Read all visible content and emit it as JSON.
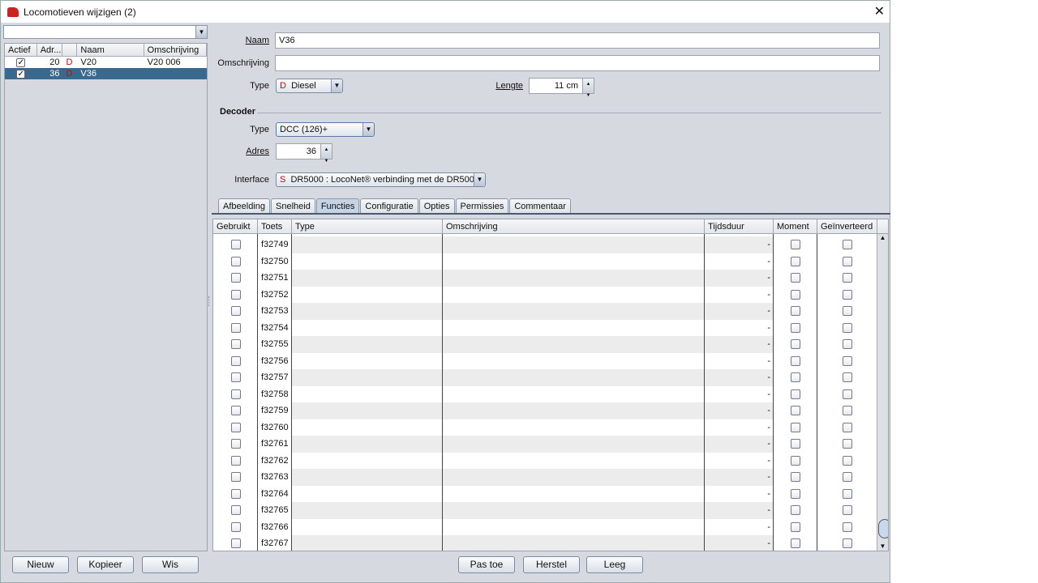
{
  "window": {
    "title": "Locomotieven wijzigen (2)",
    "close": "✕"
  },
  "left": {
    "filter_value": "",
    "columns": [
      "Actief",
      "Adr...",
      "",
      "Naam",
      "Omschrijving"
    ],
    "rows": [
      {
        "actief": true,
        "adres": "20",
        "type": "D",
        "naam": "V20",
        "omschrijving": "V20 006",
        "selected": false
      },
      {
        "actief": true,
        "adres": "36",
        "type": "D",
        "naam": "V36",
        "omschrijving": "",
        "selected": true
      }
    ],
    "buttons": [
      "Nieuw",
      "Kopieer",
      "Wis"
    ]
  },
  "form": {
    "naam_label": "Naam",
    "naam_value": "V36",
    "omschrijving_label": "Omschrijving",
    "omschrijving_value": "",
    "type_label": "Type",
    "type_prefix": "D",
    "type_value": "Diesel",
    "lengte_label": "Lengte",
    "lengte_value": "11 cm",
    "decoder_heading": "Decoder",
    "dec_type_label": "Type",
    "dec_type_value": "DCC (126)+",
    "adres_label": "Adres",
    "adres_value": "36",
    "interface_label": "Interface",
    "interface_prefix": "S",
    "interface_value": "DR5000 : LocoNet® verbinding met de DR5000"
  },
  "tabs": [
    {
      "label": "Afbeelding"
    },
    {
      "label": "Snelheid"
    },
    {
      "label": "Functies",
      "active": true
    },
    {
      "label": "Configuratie"
    },
    {
      "label": "Opties"
    },
    {
      "label": "Permissies"
    },
    {
      "label": "Commentaar"
    }
  ],
  "functions": {
    "columns": [
      "Gebruikt",
      "Toets",
      "Type",
      "Omschrijving",
      "Tijdsduur",
      "Moment",
      "Geïnverteerd"
    ],
    "rows": [
      "f32749",
      "f32750",
      "f32751",
      "f32752",
      "f32753",
      "f32754",
      "f32755",
      "f32756",
      "f32757",
      "f32758",
      "f32759",
      "f32760",
      "f32761",
      "f32762",
      "f32763",
      "f32764",
      "f32765",
      "f32766",
      "f32767"
    ],
    "tijdsduur": "-",
    "scroll_position_percent": 98
  },
  "bottom_buttons": [
    "Pas toe",
    "Herstel",
    "Leeg"
  ],
  "colors": {
    "selection": "#39698f",
    "type_letter": "#b01010"
  }
}
